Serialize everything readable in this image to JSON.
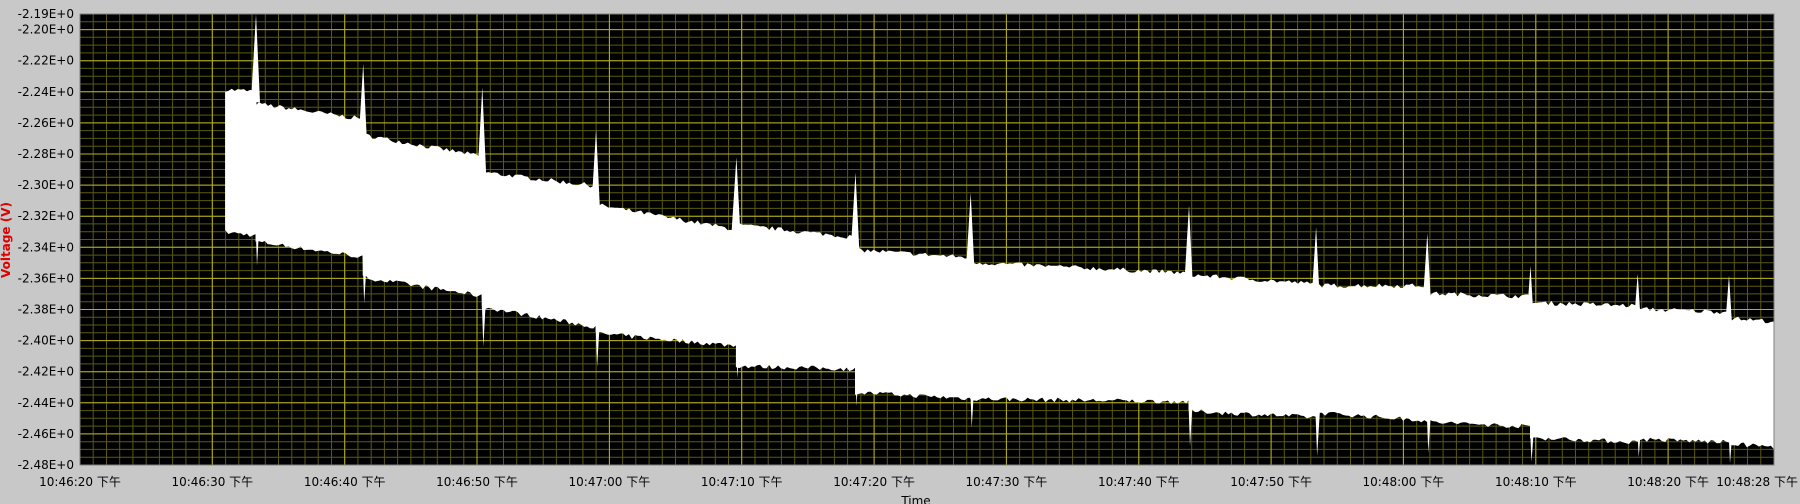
{
  "colors": {
    "panel_bg": "#c8c8c8",
    "plot_bg": "#000000",
    "major_grid": "#b7b21c",
    "minor_grid": "#5a5a10",
    "trace": "#ffffff",
    "ylabel": "#e00000",
    "text": "#000000"
  },
  "chart_data": {
    "type": "line",
    "title": "",
    "xlabel": "Time",
    "ylabel": "Voltage (V)",
    "ylim": [
      -2.48,
      -2.19
    ],
    "grid": true,
    "y_ticks": [
      {
        "value": -2.19,
        "label": "-2.19E+0"
      },
      {
        "value": -2.2,
        "label": "-2.20E+0"
      },
      {
        "value": -2.22,
        "label": "-2.22E+0"
      },
      {
        "value": -2.24,
        "label": "-2.24E+0"
      },
      {
        "value": -2.26,
        "label": "-2.26E+0"
      },
      {
        "value": -2.28,
        "label": "-2.28E+0"
      },
      {
        "value": -2.3,
        "label": "-2.30E+0"
      },
      {
        "value": -2.32,
        "label": "-2.32E+0"
      },
      {
        "value": -2.34,
        "label": "-2.34E+0"
      },
      {
        "value": -2.36,
        "label": "-2.36E+0"
      },
      {
        "value": -2.38,
        "label": "-2.38E+0"
      },
      {
        "value": -2.4,
        "label": "-2.40E+0"
      },
      {
        "value": -2.42,
        "label": "-2.42E+0"
      },
      {
        "value": -2.44,
        "label": "-2.44E+0"
      },
      {
        "value": -2.46,
        "label": "-2.46E+0"
      },
      {
        "value": -2.48,
        "label": "-2.48E+0"
      }
    ],
    "x_range": [
      "10:46:20",
      "10:48:28"
    ],
    "x_ticks": [
      {
        "value": "10:46:20",
        "label": "10:46:20 下午"
      },
      {
        "value": "10:46:30",
        "label": "10:46:30 下午"
      },
      {
        "value": "10:46:40",
        "label": "10:46:40 下午"
      },
      {
        "value": "10:46:50",
        "label": "10:46:50 下午"
      },
      {
        "value": "10:47:00",
        "label": "10:47:00 下午"
      },
      {
        "value": "10:47:10",
        "label": "10:47:10 下午"
      },
      {
        "value": "10:47:20",
        "label": "10:47:20 下午"
      },
      {
        "value": "10:47:30",
        "label": "10:47:30 下午"
      },
      {
        "value": "10:47:40",
        "label": "10:47:40 下午"
      },
      {
        "value": "10:47:50",
        "label": "10:47:50 下午"
      },
      {
        "value": "10:48:00",
        "label": "10:48:00 下午"
      },
      {
        "value": "10:48:10",
        "label": "10:48:10 下午"
      },
      {
        "value": "10:48:20",
        "label": "10:48:20 下午"
      },
      {
        "value": "10:48:28",
        "label": "10:48:28 下午"
      }
    ],
    "series": [
      {
        "style": "filled noise envelope",
        "segments": [
          {
            "start": "10:46:31.0",
            "end": "10:46:33.3",
            "upper": [
              -2.239,
              -2.24
            ],
            "lower": [
              -2.33,
              -2.332
            ]
          },
          {
            "start": "10:46:33.3",
            "end": "10:46:41.4",
            "upper": [
              -2.248,
              -2.258
            ],
            "lower": [
              -2.336,
              -2.346
            ]
          },
          {
            "start": "10:46:41.4",
            "end": "10:46:50.4",
            "upper": [
              -2.268,
              -2.282
            ],
            "lower": [
              -2.359,
              -2.371
            ]
          },
          {
            "start": "10:46:50.4",
            "end": "10:46:59.0",
            "upper": [
              -2.292,
              -2.301
            ],
            "lower": [
              -2.378,
              -2.391
            ]
          },
          {
            "start": "10:46:59.0",
            "end": "10:47:09.6",
            "upper": [
              -2.313,
              -2.329
            ],
            "lower": [
              -2.395,
              -2.403
            ]
          },
          {
            "start": "10:47:09.6",
            "end": "10:47:18.6",
            "upper": [
              -2.326,
              -2.334
            ],
            "lower": [
              -2.416,
              -2.418
            ]
          },
          {
            "start": "10:47:18.6",
            "end": "10:47:27.3",
            "upper": [
              -2.342,
              -2.347
            ],
            "lower": [
              -2.433,
              -2.437
            ]
          },
          {
            "start": "10:47:27.3",
            "end": "10:47:43.8",
            "upper": [
              -2.35,
              -2.357
            ],
            "lower": [
              -2.437,
              -2.439
            ]
          },
          {
            "start": "10:47:43.8",
            "end": "10:47:53.4",
            "upper": [
              -2.358,
              -2.364
            ],
            "lower": [
              -2.445,
              -2.449
            ]
          },
          {
            "start": "10:47:53.4",
            "end": "10:48:01.8",
            "upper": [
              -2.365,
              -2.365
            ],
            "lower": [
              -2.446,
              -2.451
            ]
          },
          {
            "start": "10:48:01.8",
            "end": "10:48:09.6",
            "upper": [
              -2.37,
              -2.372
            ],
            "lower": [
              -2.452,
              -2.455
            ]
          },
          {
            "start": "10:48:09.6",
            "end": "10:48:17.7",
            "upper": [
              -2.376,
              -2.378
            ],
            "lower": [
              -2.462,
              -2.465
            ]
          },
          {
            "start": "10:48:17.7",
            "end": "10:48:24.6",
            "upper": [
              -2.38,
              -2.382
            ],
            "lower": [
              -2.463,
              -2.465
            ]
          },
          {
            "start": "10:48:24.6",
            "end": "10:48:28.0",
            "upper": [
              -2.386,
              -2.388
            ],
            "lower": [
              -2.466,
              -2.468
            ]
          }
        ],
        "spikes": [
          {
            "t": "10:46:33.3",
            "high": -2.19,
            "low": -2.352
          },
          {
            "t": "10:46:41.4",
            "high": -2.222,
            "low": -2.376
          },
          {
            "t": "10:46:50.4",
            "high": -2.237,
            "low": -2.404
          },
          {
            "t": "10:46:59.0",
            "high": -2.264,
            "low": -2.417
          },
          {
            "t": "10:47:09.6",
            "high": -2.282,
            "low": -2.424
          },
          {
            "t": "10:47:18.6",
            "high": -2.292,
            "low": -2.442
          },
          {
            "t": "10:47:27.3",
            "high": -2.305,
            "low": -2.456
          },
          {
            "t": "10:47:43.8",
            "high": -2.313,
            "low": -2.468
          },
          {
            "t": "10:47:53.4",
            "high": -2.327,
            "low": -2.474
          },
          {
            "t": "10:48:01.8",
            "high": -2.331,
            "low": -2.472
          },
          {
            "t": "10:48:09.6",
            "high": -2.352,
            "low": -2.478
          },
          {
            "t": "10:48:17.7",
            "high": -2.357,
            "low": -2.475
          },
          {
            "t": "10:48:24.6",
            "high": -2.358,
            "low": -2.479
          }
        ]
      }
    ]
  }
}
